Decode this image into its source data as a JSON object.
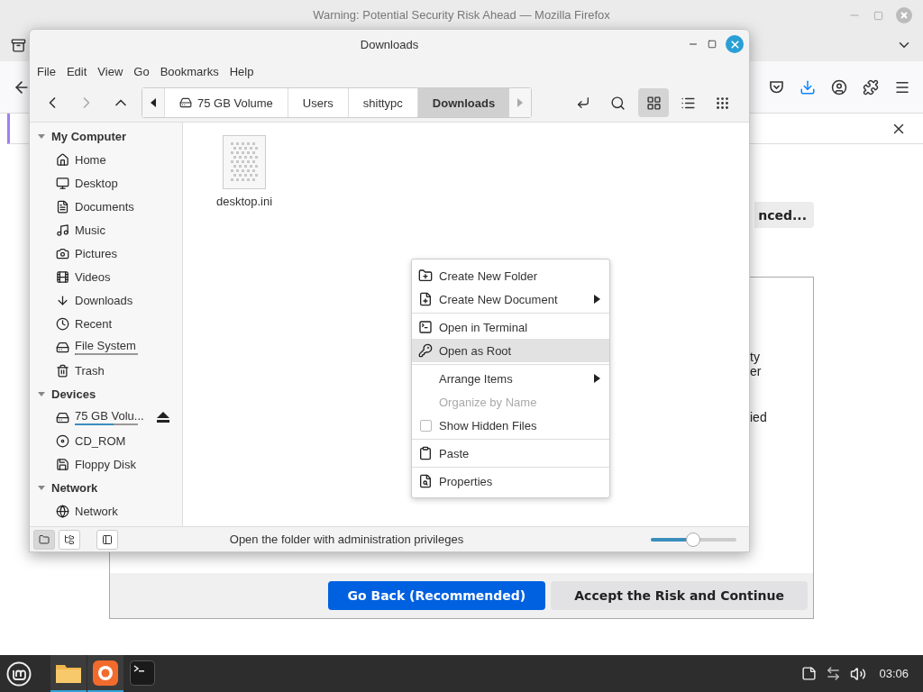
{
  "browser": {
    "title": "Warning: Potential Security Risk Ahead — Mozilla Firefox",
    "advanced_button": "nced...",
    "text_fragments": [
      "ty",
      "er",
      "ied"
    ],
    "buttons": [
      {
        "label": "Go Back (Recommended)",
        "kind": "primary"
      },
      {
        "label": "Accept the Risk and Continue",
        "kind": "secondary"
      }
    ]
  },
  "file_manager": {
    "title": "Downloads",
    "menu": [
      "File",
      "Edit",
      "View",
      "Go",
      "Bookmarks",
      "Help"
    ],
    "breadcrumb": [
      {
        "label": "75 GB Volume",
        "kind": "drive",
        "selected": false
      },
      {
        "label": "Users",
        "kind": "folder",
        "selected": false
      },
      {
        "label": "shittypc",
        "kind": "folder",
        "selected": false
      },
      {
        "label": "Downloads",
        "kind": "folder",
        "selected": true
      }
    ],
    "view_modes": [
      {
        "kind": "icons",
        "selected": true
      },
      {
        "kind": "list",
        "selected": false
      },
      {
        "kind": "compact",
        "selected": false
      }
    ],
    "sidebar": [
      {
        "title": "My Computer",
        "expanded": true,
        "items": [
          {
            "label": "Home",
            "kind": "home"
          },
          {
            "label": "Desktop",
            "kind": "desktop"
          },
          {
            "label": "Documents",
            "kind": "documents"
          },
          {
            "label": "Music",
            "kind": "music"
          },
          {
            "label": "Pictures",
            "kind": "pictures"
          },
          {
            "label": "Videos",
            "kind": "videos"
          },
          {
            "label": "Downloads",
            "kind": "downloads"
          },
          {
            "label": "Recent",
            "kind": "recent"
          },
          {
            "label": "File System",
            "kind": "filesystem",
            "level": 0.02
          },
          {
            "label": "Trash",
            "kind": "trash"
          }
        ]
      },
      {
        "title": "Devices",
        "expanded": true,
        "items": [
          {
            "label": "75 GB Volu...",
            "kind": "drive",
            "level": 0.62,
            "ejectable": true
          },
          {
            "label": "CD_ROM",
            "kind": "cdrom"
          },
          {
            "label": "Floppy Disk",
            "kind": "floppy"
          }
        ]
      },
      {
        "title": "Network",
        "expanded": true,
        "items": [
          {
            "label": "Network",
            "kind": "network"
          }
        ]
      }
    ],
    "files": [
      {
        "name": "desktop.ini"
      }
    ],
    "pane_buttons": [
      {
        "kind": "places",
        "selected": true
      },
      {
        "kind": "tree",
        "selected": false
      }
    ],
    "status": "Open the folder with administration privileges",
    "zoom": {
      "level": 0.49
    }
  },
  "context_menu": [
    [
      {
        "label": "Create New Folder",
        "kind": "new-folder",
        "submenu": false,
        "disabled": false,
        "selected": false
      },
      {
        "label": "Create New Document",
        "kind": "new-document",
        "submenu": true,
        "disabled": false,
        "selected": false
      }
    ],
    [
      {
        "label": "Open in Terminal",
        "kind": "terminal",
        "submenu": false,
        "disabled": false,
        "selected": false
      },
      {
        "label": "Open as Root",
        "kind": "key",
        "submenu": false,
        "disabled": false,
        "selected": true
      }
    ],
    [
      {
        "label": "Arrange Items",
        "kind": "plain",
        "submenu": true,
        "disabled": false,
        "selected": false
      },
      {
        "label": "Organize by Name",
        "kind": "plain",
        "submenu": false,
        "disabled": true,
        "selected": false
      },
      {
        "label": "Show Hidden Files",
        "kind": "checkbox",
        "checked": false,
        "submenu": false,
        "disabled": false,
        "selected": false
      }
    ],
    [
      {
        "label": "Paste",
        "kind": "paste",
        "submenu": false,
        "disabled": false,
        "selected": false
      }
    ],
    [
      {
        "label": "Properties",
        "kind": "properties",
        "submenu": false,
        "disabled": false,
        "selected": false
      }
    ]
  ],
  "taskbar": {
    "apps": [
      {
        "kind": "files",
        "active": true
      },
      {
        "kind": "browser",
        "active": true
      },
      {
        "kind": "terminal",
        "active": false
      }
    ],
    "clock": "03:06"
  }
}
